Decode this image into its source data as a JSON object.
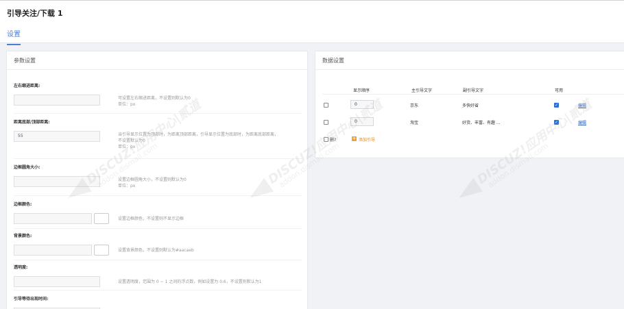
{
  "header": {
    "title": "引导关注/下载 1",
    "tabs": [
      {
        "label": "设置"
      }
    ]
  },
  "params_panel": {
    "title": "参数设置",
    "fields": [
      {
        "label": "左右缩进距离:",
        "value": "",
        "hint_lines": [
          "可设置左右缩进距离，不设置则默认为0",
          "单位：px"
        ]
      },
      {
        "label": "距离底部/顶部距离:",
        "value": "55",
        "hint_lines": [
          "当引导显示位置为顶部时，为距离顶部距离，引导显示位置为底部时，为距离底部距离，",
          "不设置默认为0",
          "单位：px"
        ]
      },
      {
        "label": "边框圆角大小:",
        "value": "",
        "hint_lines": [
          "设置边框圆角大小，不设置则默认为0",
          "单位：px"
        ]
      },
      {
        "label": "边框颜色:",
        "value": "",
        "hint_lines": [
          "设置边框颜色，不设置则不显示边框"
        ]
      },
      {
        "label": "背景颜色:",
        "value": "",
        "hint_lines": [
          "设置背景颜色，不设置则默认为#aacaeb"
        ]
      },
      {
        "label": "透明度:",
        "value": "",
        "hint_lines": [
          "设置透明度，范围为 0 ~ 1 之间的浮点数，例如设置为 0.6，不设置则默认为1"
        ]
      },
      {
        "label": "引导等待出现时间:",
        "value": "",
        "hint_lines": []
      }
    ]
  },
  "data_panel": {
    "title": "数据设置",
    "columns": [
      "显示顺序",
      "主引导文字",
      "副引导文字",
      "可用"
    ],
    "rows": [
      {
        "order": "0",
        "main_text": "京东",
        "sub_text": "多快好省",
        "enabled": true,
        "edit_label": "编辑"
      },
      {
        "order": "0",
        "main_text": "淘宝",
        "sub_text": "好货、丰富、有趣 ...",
        "enabled": true,
        "edit_label": "编辑"
      }
    ],
    "delete_label": "删?",
    "add_label": "添加引导"
  },
  "watermark": {
    "brand": "DISCUZ!应用中心|贰道",
    "site": "addon.dismall.com"
  }
}
